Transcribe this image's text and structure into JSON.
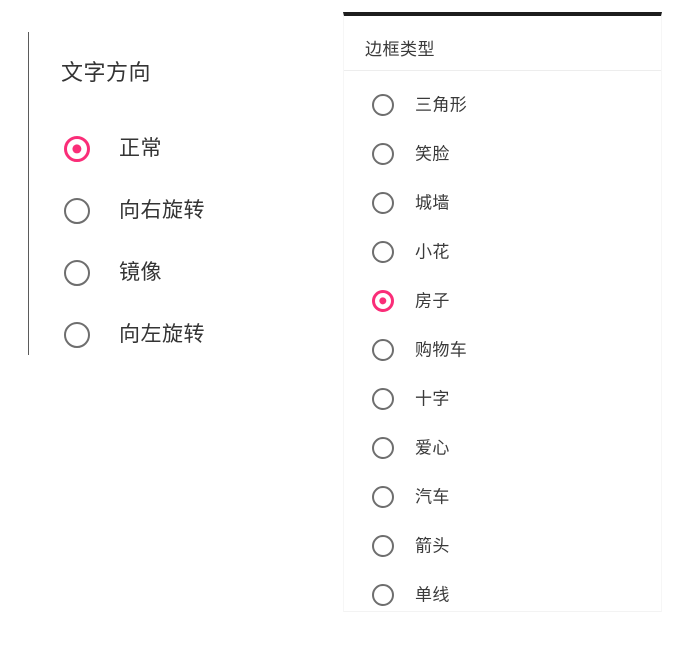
{
  "theme": {
    "accent_color": "#FA2D78",
    "radio_off_color": "#6E6E6E",
    "text_color": "#343434",
    "panel_top_border_color": "#1D1D1D",
    "divider_color": "#EDEDED",
    "background_color": "#FFFFFF"
  },
  "left_panel": {
    "heading": "文字方向",
    "selected_value": "正常",
    "options": [
      {
        "label": "正常",
        "selected": true
      },
      {
        "label": "向右旋转",
        "selected": false
      },
      {
        "label": "镜像",
        "selected": false
      },
      {
        "label": "向左旋转",
        "selected": false
      }
    ]
  },
  "right_panel": {
    "heading": "边框类型",
    "selected_value": "房子",
    "options": [
      {
        "label": "三角形",
        "selected": false
      },
      {
        "label": "笑脸",
        "selected": false
      },
      {
        "label": "城墙",
        "selected": false
      },
      {
        "label": "小花",
        "selected": false
      },
      {
        "label": "房子",
        "selected": true
      },
      {
        "label": "购物车",
        "selected": false
      },
      {
        "label": "十字",
        "selected": false
      },
      {
        "label": "爱心",
        "selected": false
      },
      {
        "label": "汽车",
        "selected": false
      },
      {
        "label": "箭头",
        "selected": false
      },
      {
        "label": "单线",
        "selected": false
      }
    ]
  }
}
